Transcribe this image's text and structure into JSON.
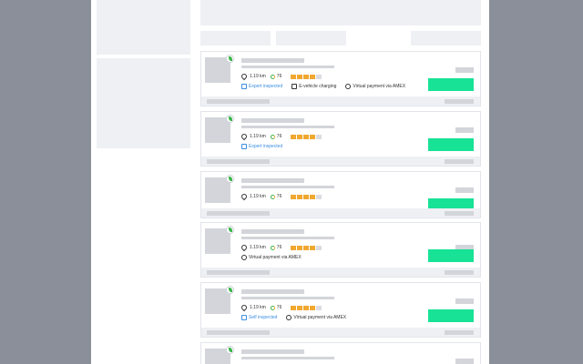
{
  "results": [
    {
      "distance": "1.19 km",
      "score": "76",
      "rating": 4,
      "rating_max": 5,
      "features": [
        {
          "label": "Expert inspected",
          "icon": "shield-icon",
          "color": "#3d8fe0"
        },
        {
          "label": "E-vehicle charging",
          "icon": "plug-icon",
          "color": "#333333"
        },
        {
          "label": "Virtual payment via AMEX",
          "icon": "card-icon",
          "color": "#333333"
        }
      ]
    },
    {
      "distance": "1.19 km",
      "score": "76",
      "rating": 4,
      "rating_max": 5,
      "features": [
        {
          "label": "Expert inspected",
          "icon": "shield-icon",
          "color": "#3d8fe0"
        }
      ]
    },
    {
      "distance": "1.19 km",
      "score": "76",
      "rating": 4,
      "rating_max": 5,
      "features": []
    },
    {
      "distance": "1.19 km",
      "score": "76",
      "rating": 4,
      "rating_max": 5,
      "features": [
        {
          "label": "Virtual payment via AMEX",
          "icon": "card-icon",
          "color": "#333333"
        }
      ]
    },
    {
      "distance": "1.19 km",
      "score": "76",
      "rating": 4,
      "rating_max": 5,
      "features": [
        {
          "label": "Self inspected",
          "icon": "check-icon",
          "color": "#3d8fe0"
        },
        {
          "label": "Virtual payment via AMEX",
          "icon": "card-icon",
          "color": "#333333"
        }
      ]
    },
    {
      "distance": "",
      "score": "",
      "rating": 0,
      "rating_max": 5,
      "features": []
    }
  ],
  "colors": {
    "backdrop": "#8a8f99",
    "book_button": "#18e296",
    "star_on": "#f0a830",
    "skeleton": "#d3d5da",
    "inspected": "#3d8fe0"
  }
}
